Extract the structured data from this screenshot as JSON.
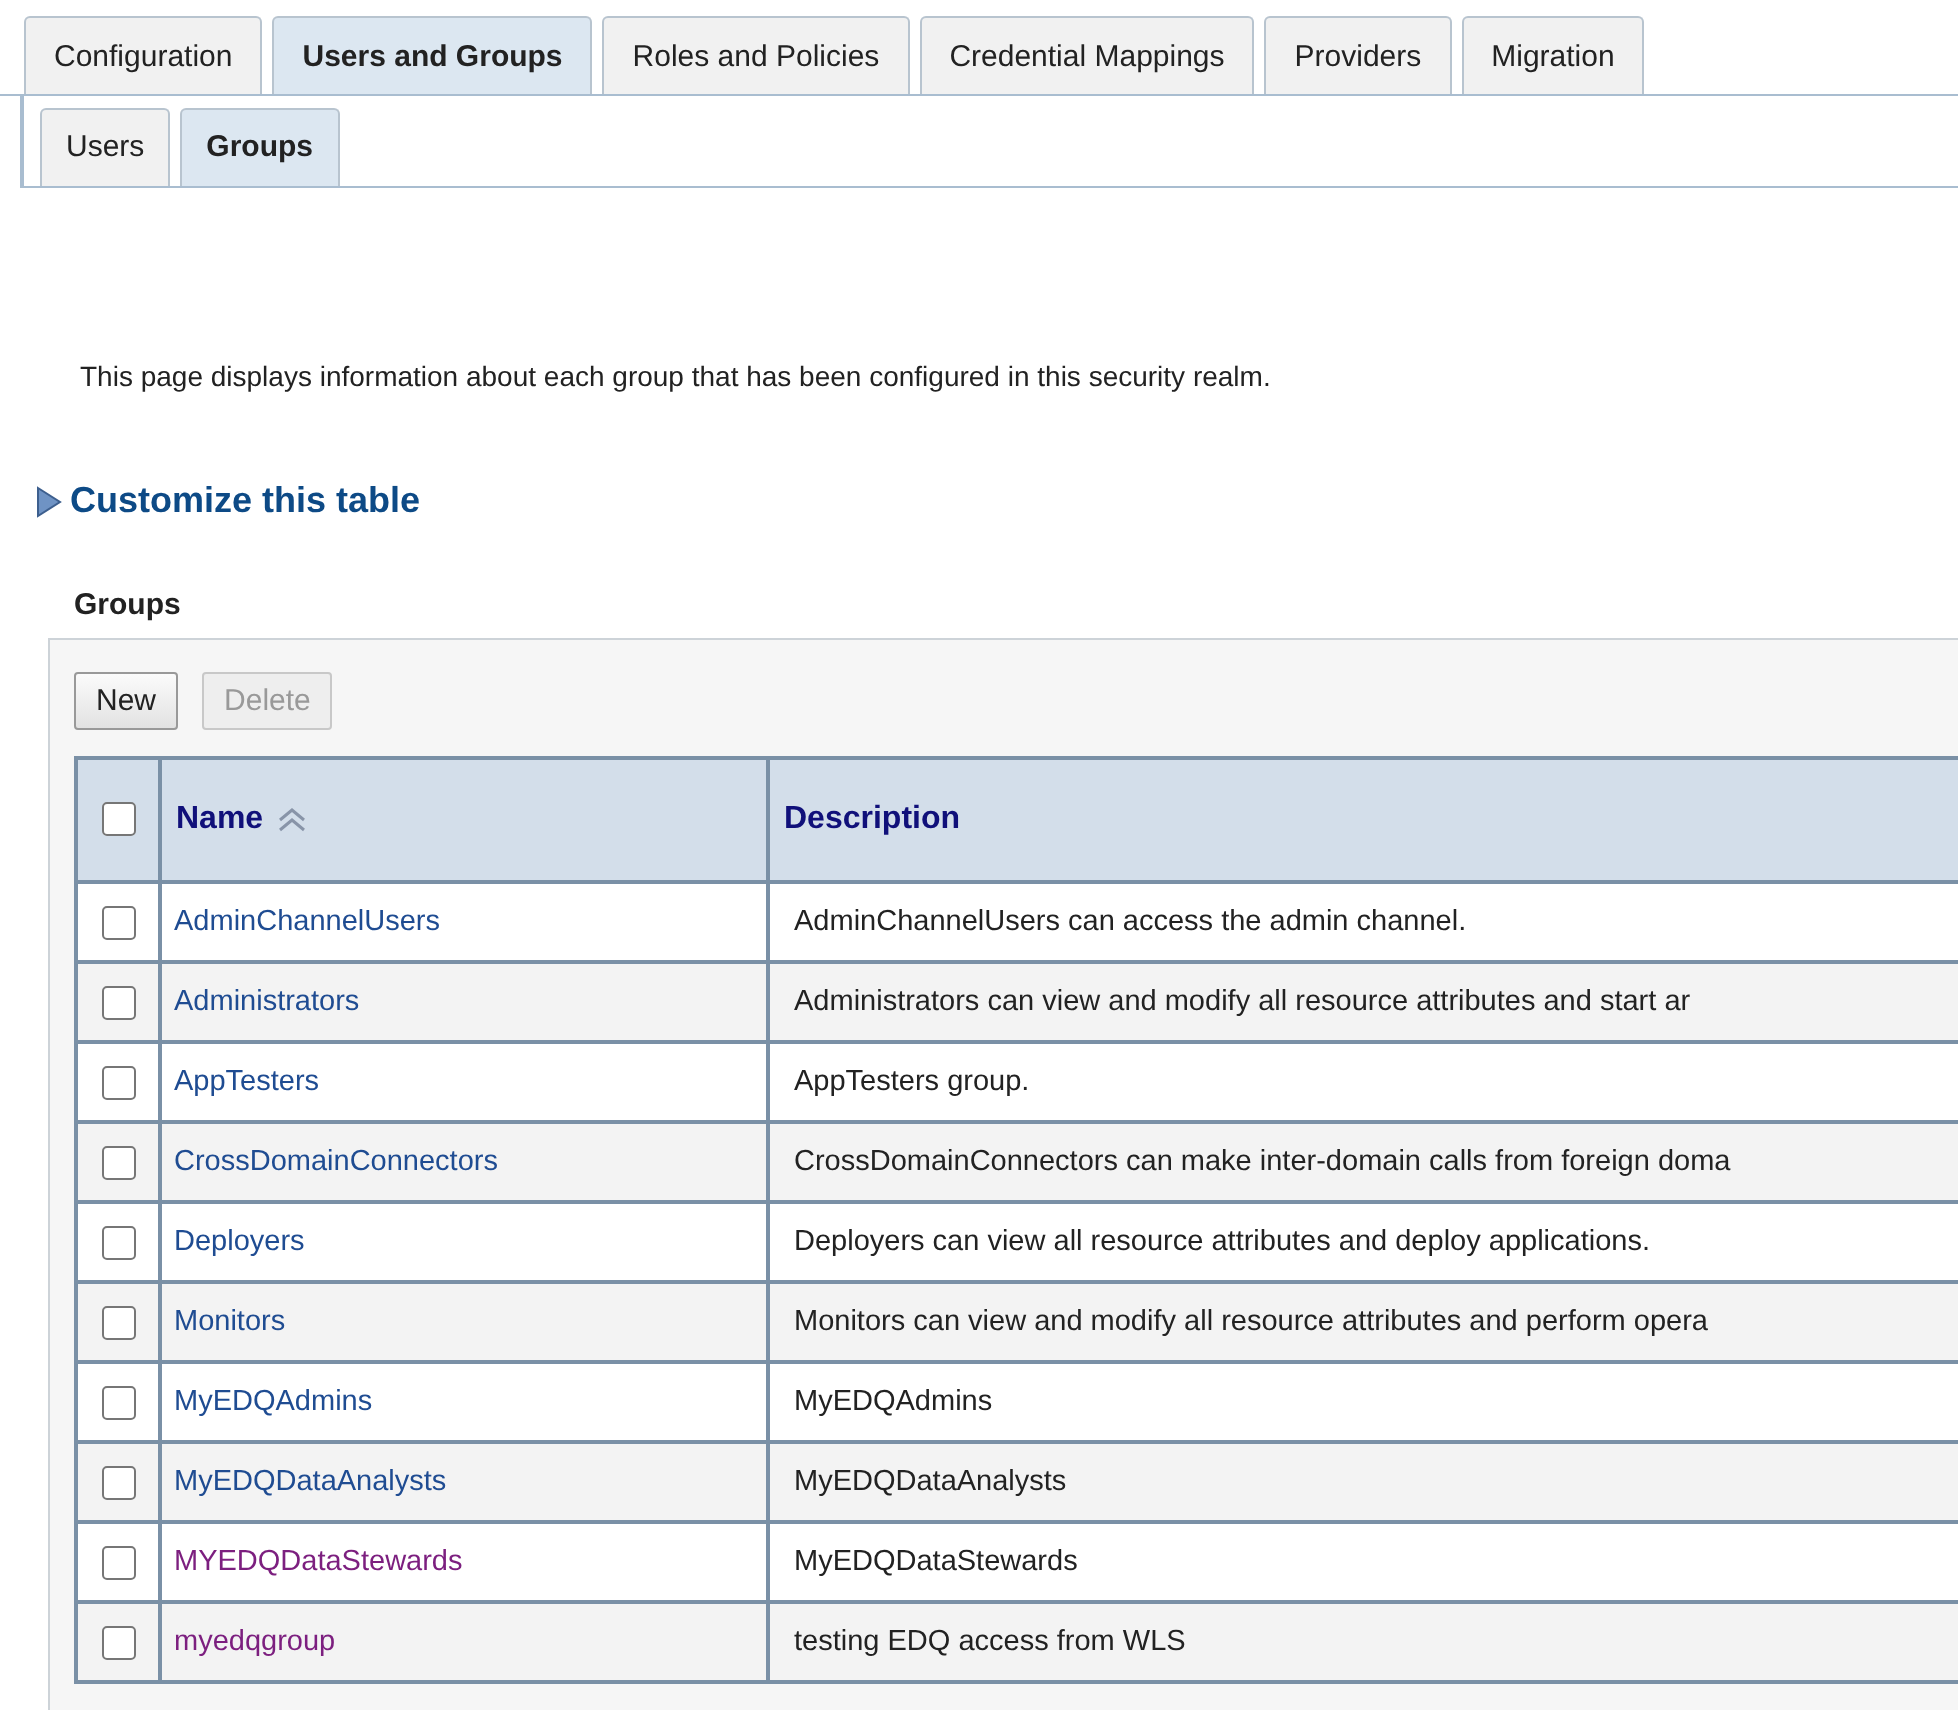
{
  "tabs": [
    {
      "label": "Configuration",
      "selected": false
    },
    {
      "label": "Users and Groups",
      "selected": true
    },
    {
      "label": "Roles and Policies",
      "selected": false
    },
    {
      "label": "Credential Mappings",
      "selected": false
    },
    {
      "label": "Providers",
      "selected": false
    },
    {
      "label": "Migration",
      "selected": false
    }
  ],
  "subtabs": [
    {
      "label": "Users",
      "selected": false
    },
    {
      "label": "Groups",
      "selected": true
    }
  ],
  "intro": "This page displays information about each group that has been configured in this security realm.",
  "customize_link": "Customize this table",
  "table_title": "Groups",
  "buttons": [
    {
      "label": "New",
      "disabled": false
    },
    {
      "label": "Delete",
      "disabled": true
    }
  ],
  "table": {
    "select_all_checked": false,
    "columns": [
      {
        "label": "Name",
        "sorted": true
      },
      {
        "label": "Description",
        "sorted": false
      }
    ],
    "rows": [
      {
        "name": "AdminChannelUsers",
        "visited": false,
        "description": "AdminChannelUsers can access the admin channel.",
        "checked": false
      },
      {
        "name": "Administrators",
        "visited": false,
        "description": "Administrators can view and modify all resource attributes and start ar",
        "checked": false
      },
      {
        "name": "AppTesters",
        "visited": false,
        "description": "AppTesters group.",
        "checked": false
      },
      {
        "name": "CrossDomainConnectors",
        "visited": false,
        "description": "CrossDomainConnectors can make inter-domain calls from foreign doma",
        "checked": false
      },
      {
        "name": "Deployers",
        "visited": false,
        "description": "Deployers can view all resource attributes and deploy applications.",
        "checked": false
      },
      {
        "name": "Monitors",
        "visited": false,
        "description": "Monitors can view and modify all resource attributes and perform opera",
        "checked": false
      },
      {
        "name": "MyEDQAdmins",
        "visited": false,
        "description": "MyEDQAdmins",
        "checked": false
      },
      {
        "name": "MyEDQDataAnalysts",
        "visited": false,
        "description": "MyEDQDataAnalysts",
        "checked": false
      },
      {
        "name": "MYEDQDataStewards",
        "visited": true,
        "description": "MyEDQDataStewards",
        "checked": false
      },
      {
        "name": "myedqgroup",
        "visited": true,
        "description": "testing EDQ access from WLS",
        "checked": false
      }
    ]
  }
}
